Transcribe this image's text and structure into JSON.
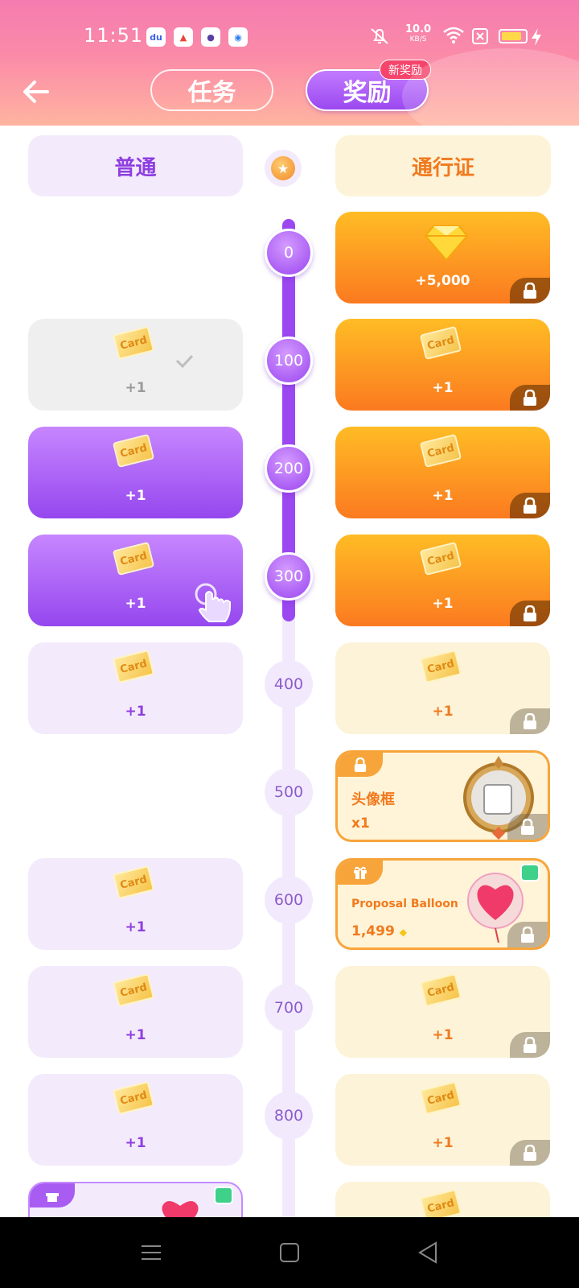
{
  "status_bar": {
    "time": "11:51",
    "speed_value": "10.0",
    "speed_unit": "KB/S"
  },
  "header": {
    "tabs": [
      {
        "label": "任务"
      },
      {
        "label": "奖励"
      }
    ],
    "new_badge": "新奖励"
  },
  "columns": {
    "normal": "普通",
    "pass": "通行证"
  },
  "levels": [
    "0",
    "100",
    "200",
    "300",
    "400",
    "500",
    "600",
    "700",
    "800"
  ],
  "ticket_text": "Card",
  "rows": [
    {
      "right": {
        "amount": "+5,000",
        "type": "diamond"
      }
    },
    {
      "left": {
        "amount": "+1",
        "state": "claimed"
      },
      "right": {
        "amount": "+1",
        "state": "locked"
      }
    },
    {
      "left": {
        "amount": "+1",
        "state": "claimable"
      },
      "right": {
        "amount": "+1",
        "state": "locked"
      }
    },
    {
      "left": {
        "amount": "+1",
        "state": "claimable"
      },
      "right": {
        "amount": "+1",
        "state": "locked"
      }
    },
    {
      "left": {
        "amount": "+1",
        "state": "pending"
      },
      "right": {
        "amount": "+1",
        "state": "locked"
      }
    },
    {
      "right": {
        "title": "头像框",
        "qty": "x1",
        "type": "frame"
      }
    },
    {
      "left": {
        "amount": "+1",
        "state": "pending"
      },
      "right": {
        "title": "Proposal Balloon",
        "price": "1,499",
        "type": "gift"
      }
    },
    {
      "left": {
        "amount": "+1",
        "state": "pending"
      },
      "right": {
        "amount": "+1",
        "state": "locked"
      }
    },
    {
      "left": {
        "amount": "+1",
        "state": "pending"
      },
      "right": {
        "amount": "+1",
        "state": "locked"
      }
    }
  ]
}
